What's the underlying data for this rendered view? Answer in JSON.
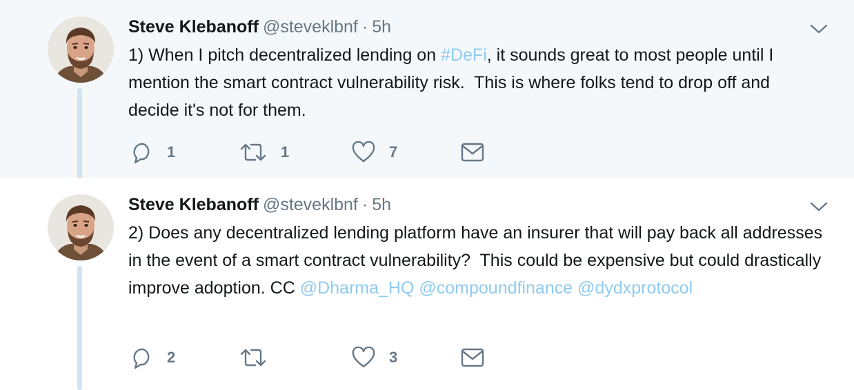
{
  "tweets": [
    {
      "author_name": "Steve Klebanoff",
      "handle": "@steveklbnf",
      "separator": "·",
      "time": "5h",
      "text_parts": [
        {
          "text": "1) When I pitch decentralized lending on ",
          "link": false
        },
        {
          "text": "#DeFi",
          "link": true
        },
        {
          "text": ", it sounds great to most people until I mention the smart contract vulnerability risk.  This is where folks tend to drop off and decide it's not for them.",
          "link": false
        }
      ],
      "replies": "1",
      "retweets": "1",
      "likes": "7",
      "icons": [
        "reply-icon",
        "retweet-icon",
        "like-icon",
        "direct-message-icon",
        "chevron-down-icon"
      ]
    },
    {
      "author_name": "Steve Klebanoff",
      "handle": "@steveklbnf",
      "separator": "·",
      "time": "5h",
      "text_parts": [
        {
          "text": "2) Does any decentralized lending platform have an insurer that will pay back all addresses in the event of a smart contract vulnerability?  This could be expensive but could drastically improve adoption. CC ",
          "link": false
        },
        {
          "text": "@Dharma_HQ",
          "link": true
        },
        {
          "text": " ",
          "link": false
        },
        {
          "text": "@compoundfinance",
          "link": true
        },
        {
          "text": " ",
          "link": false
        },
        {
          "text": "@dydxprotocol",
          "link": true
        }
      ],
      "replies": "2",
      "retweets": "",
      "likes": "3",
      "icons": [
        "reply-icon",
        "retweet-icon",
        "like-icon",
        "direct-message-icon",
        "chevron-down-icon"
      ]
    }
  ],
  "colors": {
    "highlight_bg": "#f5f8fa",
    "link": "#8fcbf0",
    "muted": "#657786",
    "thread_line": "#d0e4f4"
  }
}
